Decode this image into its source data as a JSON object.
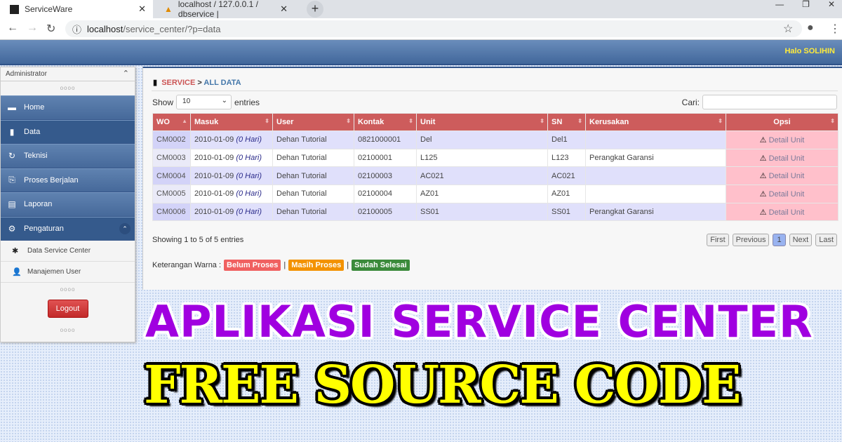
{
  "browser": {
    "tabs": [
      {
        "title": "ServiceWare",
        "active": true
      },
      {
        "title": "localhost / 127.0.0.1 / dbservice |",
        "active": false
      }
    ],
    "url_host": "localhost",
    "url_path": "/service_center/?p=data"
  },
  "header": {
    "greeting": "Halo SOLIHIN"
  },
  "sidebar": {
    "role": "Administrator",
    "items": [
      {
        "label": "Home",
        "icon": "inbox-icon"
      },
      {
        "label": "Data",
        "icon": "book-icon"
      },
      {
        "label": "Teknisi",
        "icon": "refresh-icon"
      },
      {
        "label": "Proses Berjalan",
        "icon": "paperclip-icon"
      },
      {
        "label": "Laporan",
        "icon": "file-icon"
      },
      {
        "label": "Pengaturan",
        "icon": "gear-icon"
      }
    ],
    "sub_items": [
      {
        "label": "Data Service Center",
        "icon": "asterisk-icon"
      },
      {
        "label": "Manajemen User",
        "icon": "user-icon"
      }
    ],
    "logout": "Logout"
  },
  "main": {
    "crumb_a": "SERVICE",
    "crumb_sep": " > ",
    "crumb_b": "ALL DATA",
    "show": "Show",
    "entries": "entries",
    "page_size": "10",
    "search_label": "Cari:",
    "search_value": "",
    "columns": [
      "WO",
      "Masuk",
      "User",
      "Kontak",
      "Unit",
      "SN",
      "Kerusakan",
      "Opsi"
    ],
    "rows": [
      {
        "wo": "CM0002",
        "date": "2010-01-09",
        "days": "(0 Hari)",
        "user": "Dehan Tutorial",
        "kontak": "0821000001",
        "unit": "Del",
        "sn": "Del1",
        "kerusakan": "",
        "opsi": "Detail Unit"
      },
      {
        "wo": "CM0003",
        "date": "2010-01-09",
        "days": "(0 Hari)",
        "user": "Dehan Tutorial",
        "kontak": "02100001",
        "unit": "L125",
        "sn": "L123",
        "kerusakan": "Perangkat Garansi",
        "opsi": "Detail Unit"
      },
      {
        "wo": "CM0004",
        "date": "2010-01-09",
        "days": "(0 Hari)",
        "user": "Dehan Tutorial",
        "kontak": "02100003",
        "unit": "AC021",
        "sn": "AC021",
        "kerusakan": "",
        "opsi": "Detail Unit"
      },
      {
        "wo": "CM0005",
        "date": "2010-01-09",
        "days": "(0 Hari)",
        "user": "Dehan Tutorial",
        "kontak": "02100004",
        "unit": "AZ01",
        "sn": "AZ01",
        "kerusakan": "",
        "opsi": "Detail Unit"
      },
      {
        "wo": "CM0006",
        "date": "2010-01-09",
        "days": "(0 Hari)",
        "user": "Dehan Tutorial",
        "kontak": "02100005",
        "unit": "SS01",
        "sn": "SS01",
        "kerusakan": "Perangkat Garansi",
        "opsi": "Detail Unit"
      }
    ],
    "info": "Showing 1 to 5 of 5 entries",
    "pager": [
      "First",
      "Previous",
      "1",
      "Next",
      "Last"
    ],
    "legend_label": "Keterangan Warna :",
    "legend": [
      {
        "label": "Belum Proses",
        "color": "#f06060"
      },
      {
        "label": "Masih Proses",
        "color": "#f39200"
      },
      {
        "label": "Sudah Selesai",
        "color": "#3a8a3a"
      }
    ]
  },
  "overlay": {
    "line1": "APLIKASI SERVICE CENTER",
    "line2": "FREE SOURCE CODE"
  }
}
